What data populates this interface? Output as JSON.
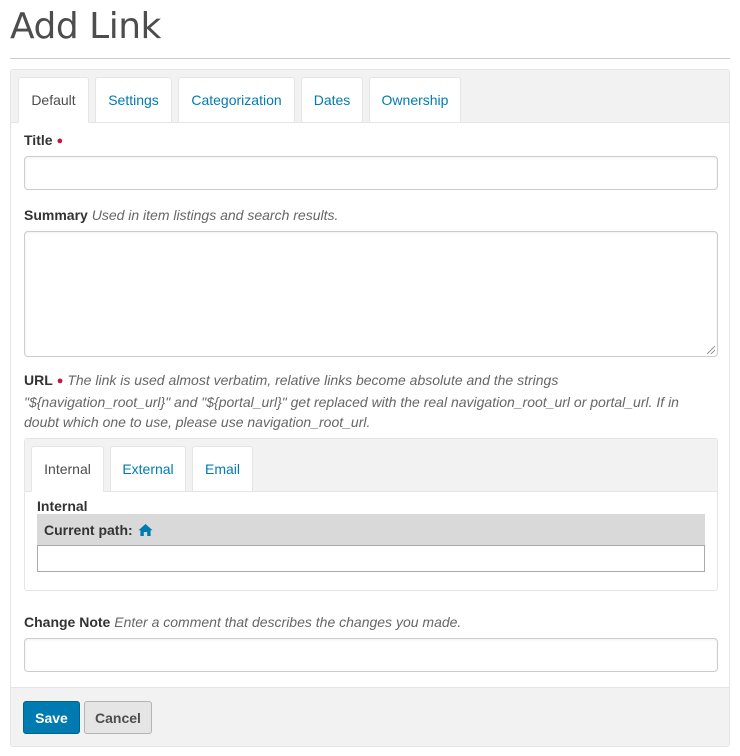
{
  "page": {
    "title": "Add Link"
  },
  "tabs": [
    {
      "label": "Default"
    },
    {
      "label": "Settings"
    },
    {
      "label": "Categorization"
    },
    {
      "label": "Dates"
    },
    {
      "label": "Ownership"
    }
  ],
  "active_tab": "Default",
  "fields": {
    "title": {
      "label": "Title",
      "value": ""
    },
    "summary": {
      "label": "Summary",
      "help": "Used in item listings and search results.",
      "value": ""
    },
    "url": {
      "label": "URL",
      "help": "The link is used almost verbatim, relative links become absolute and the strings \"${navigation_root_url}\" and \"${portal_url}\" get replaced with the real navigation_root_url or portal_url. If in doubt which one to use, please use navigation_root_url.",
      "tabs": [
        {
          "label": "Internal"
        },
        {
          "label": "External"
        },
        {
          "label": "Email"
        }
      ],
      "active_tab": "Internal",
      "internal": {
        "label": "Internal",
        "current_path_label": "Current path:",
        "value": ""
      }
    },
    "change_note": {
      "label": "Change Note",
      "help": "Enter a comment that describes the changes you made.",
      "value": ""
    }
  },
  "buttons": {
    "save": "Save",
    "cancel": "Cancel"
  },
  "colors": {
    "link": "#007bb1",
    "required": "#c4183c",
    "primary_button": "#007bb1"
  },
  "icons": {
    "current_path": "home-icon",
    "required": "required-dot"
  }
}
